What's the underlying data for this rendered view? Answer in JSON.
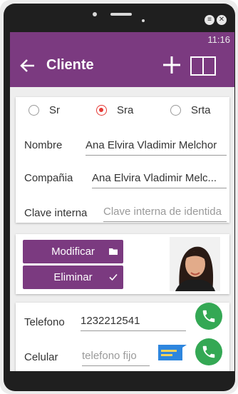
{
  "status_bar": {
    "time": "11:16"
  },
  "app_bar": {
    "title": "Cliente"
  },
  "radio_group": {
    "options": [
      {
        "label": "Sr",
        "selected": false
      },
      {
        "label": "Sra",
        "selected": true
      },
      {
        "label": "Srta",
        "selected": false
      }
    ]
  },
  "form": {
    "nombre": {
      "label": "Nombre",
      "value": "Ana Elvira Vladimir Melchor"
    },
    "compania": {
      "label": "Compañia",
      "value": "Ana Elvira Vladimir Melc..."
    },
    "clave_interna": {
      "label": "Clave interna",
      "placeholder": "Clave interna de identida"
    }
  },
  "actions": {
    "modify_label": "Modificar",
    "delete_label": "Eliminar"
  },
  "contact": {
    "telefono": {
      "label": "Telefono",
      "value": "1232212541"
    },
    "celular": {
      "label": "Celular",
      "placeholder": "telefono fijo"
    }
  },
  "colors": {
    "primary": "#7b3a80",
    "call_green": "#34a854",
    "radio_selected": "#e53935",
    "sms_blue": "#2e86de"
  },
  "icons": {
    "back": "back-arrow-icon",
    "add": "plus-icon",
    "contacts_book": "book-icon",
    "folder": "folder-icon",
    "check": "check-icon",
    "call": "phone-icon",
    "sms": "message-icon"
  }
}
